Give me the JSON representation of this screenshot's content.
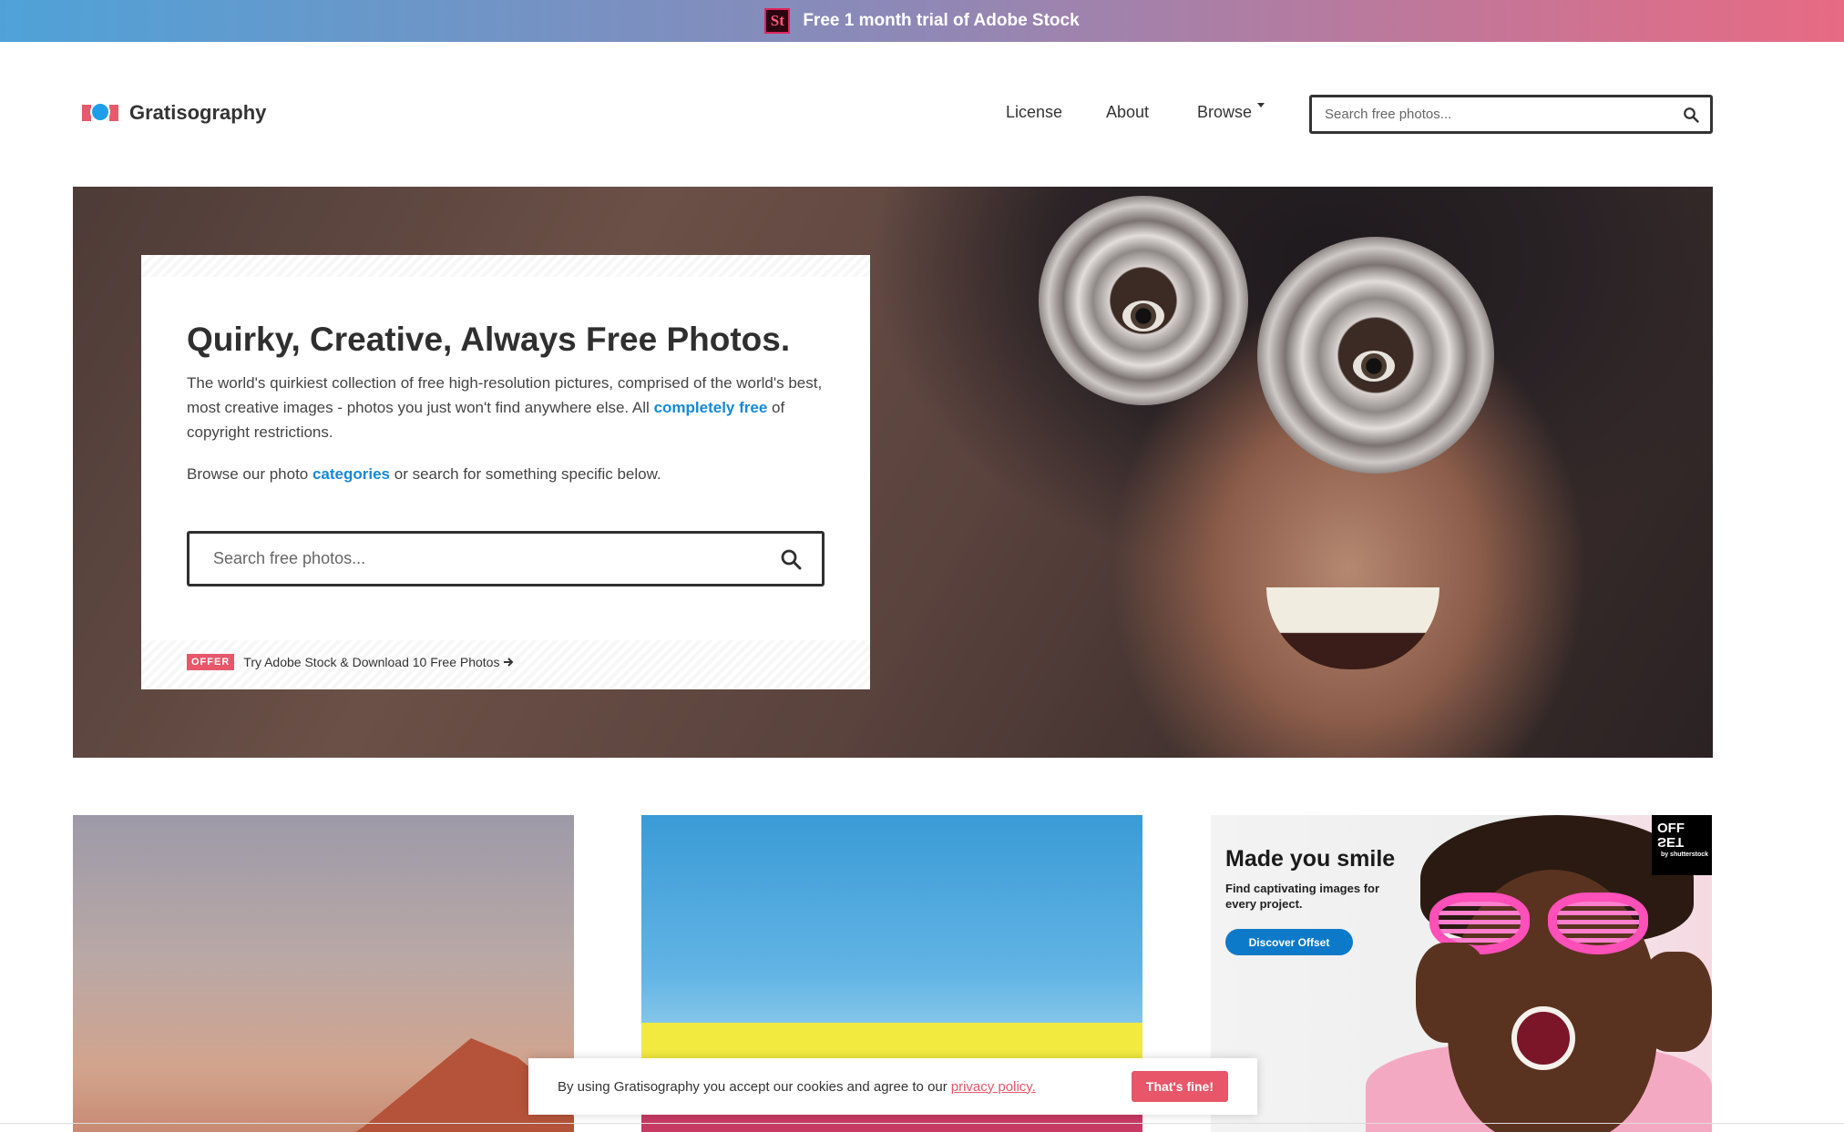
{
  "promo": {
    "badge": "St",
    "text": "Free 1 month trial of Adobe Stock"
  },
  "header": {
    "brand": "Gratisography",
    "nav": {
      "license": "License",
      "about": "About",
      "browse": "Browse"
    },
    "search_placeholder": "Search free photos..."
  },
  "hero": {
    "title": "Quirky, Creative, Always Free Photos.",
    "desc_part1": "The world's quirkiest collection of free high-resolution pictures, comprised of the world's best, most creative images - photos you just won't find anywhere else. All ",
    "desc_link": "completely free",
    "desc_part2": " of copyright restrictions.",
    "browse_part1": "Browse our photo ",
    "browse_link": "categories",
    "browse_part2": " or search for something specific below.",
    "search_placeholder": "Search free photos...",
    "offer_badge": "OFFER",
    "offer_text": "Try Adobe Stock & Download 10 Free Photos"
  },
  "ad": {
    "title": "Made you smile",
    "subtitle": "Find captivating images for every project.",
    "button": "Discover Offset",
    "logo_line1": "OFF",
    "logo_line2": "SET",
    "logo_small": "by shutterstock"
  },
  "cookie": {
    "text": "By using Gratisography you accept our cookies and agree to our",
    "link": "privacy policy.",
    "button": "That's fine!"
  },
  "colors": {
    "accent": "#1589d8",
    "offer": "#e8566a",
    "ad_button": "#0d7ac9"
  }
}
